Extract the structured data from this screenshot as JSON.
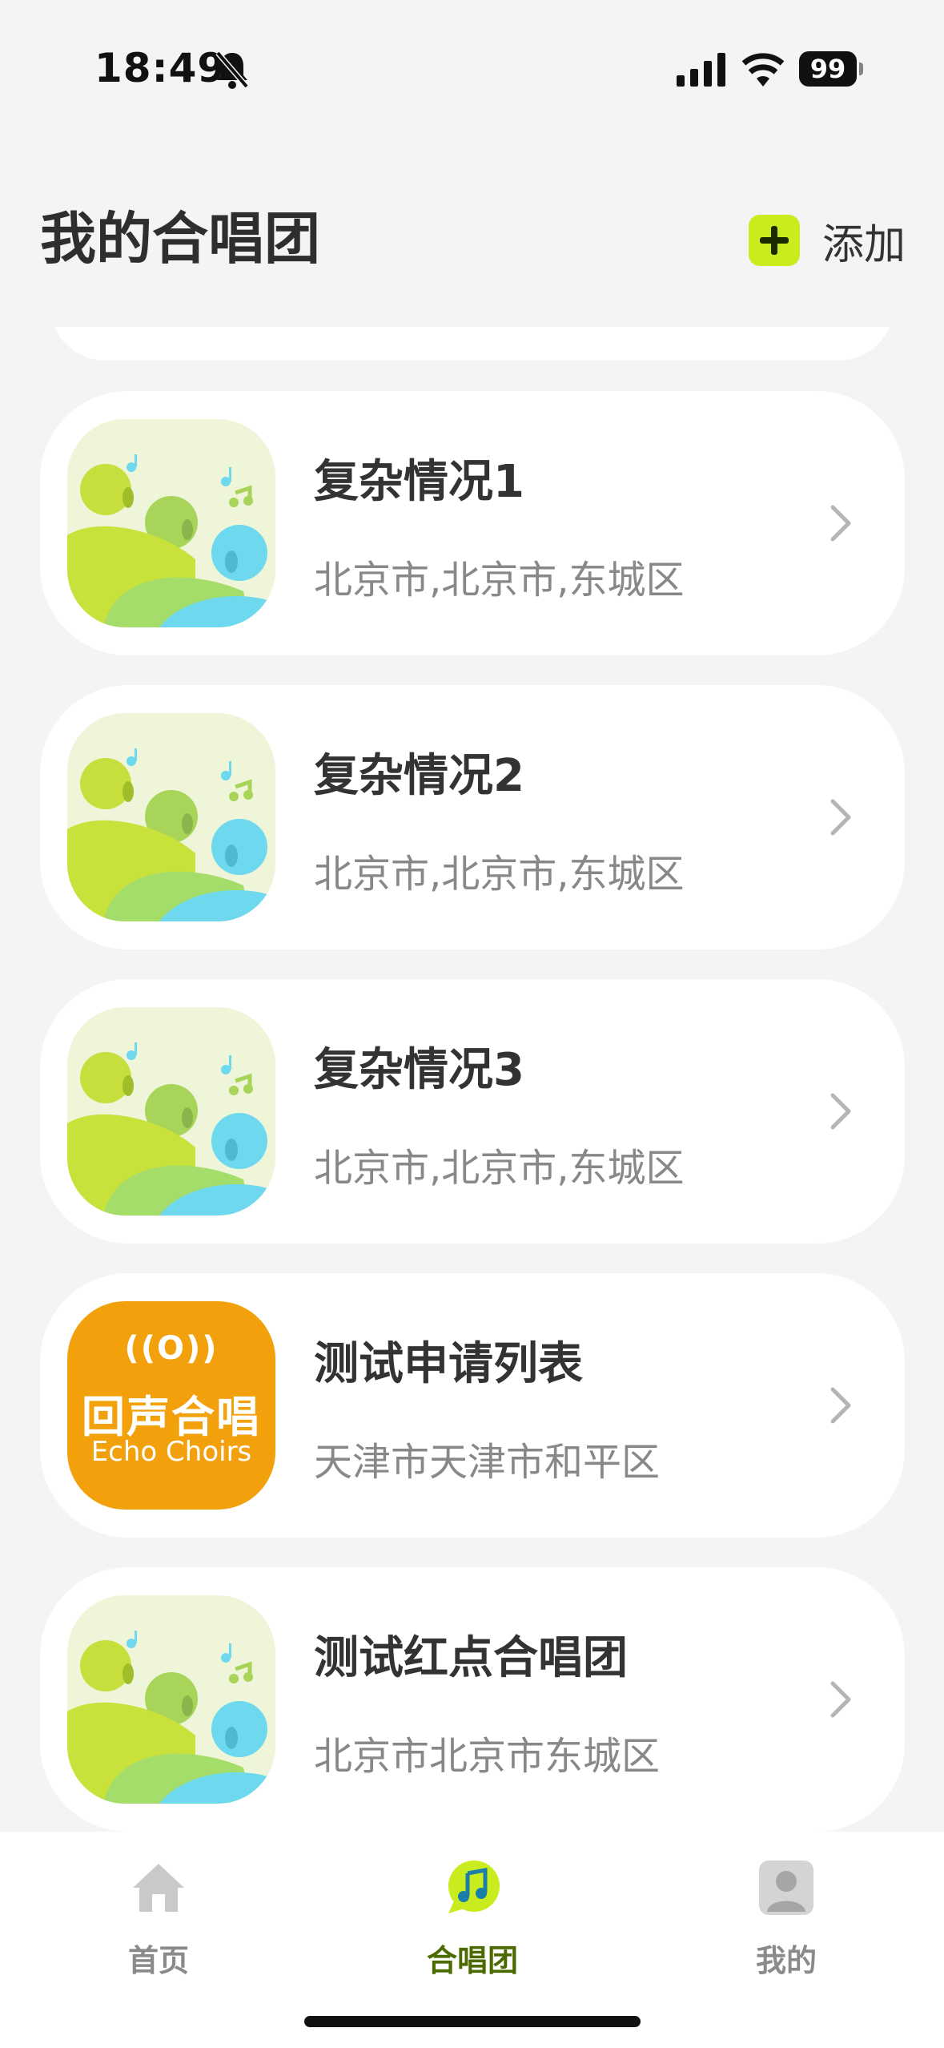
{
  "status_bar": {
    "time": "18:49",
    "battery": "99"
  },
  "header": {
    "title": "我的合唱团",
    "add_label": "添加"
  },
  "choirs": [
    {
      "name": "复杂情况1",
      "location": "北京市,北京市,东城区",
      "thumb": "choir-people-art"
    },
    {
      "name": "复杂情况2",
      "location": "北京市,北京市,东城区",
      "thumb": "choir-people-art"
    },
    {
      "name": "复杂情况3",
      "location": "北京市,北京市,东城区",
      "thumb": "choir-people-art"
    },
    {
      "name": "测试申请列表",
      "location": "天津市天津市和平区",
      "thumb": "echo-choirs-logo",
      "logo": {
        "waves": "((O))",
        "cn": "回声合唱",
        "en": "Echo Choirs"
      }
    },
    {
      "name": "测试红点合唱团",
      "location": "北京市北京市东城区",
      "thumb": "choir-people-art"
    }
  ],
  "tabs": [
    {
      "label": "首页",
      "icon": "home-icon",
      "active": false
    },
    {
      "label": "合唱团",
      "icon": "music-note-icon",
      "active": true
    },
    {
      "label": "我的",
      "icon": "profile-icon",
      "active": false
    }
  ],
  "colors": {
    "accent": "#c8ec1e",
    "active_tab": "#4b6a00",
    "logo_orange": "#f2a10d",
    "art_teal": "#6dd8ee"
  }
}
